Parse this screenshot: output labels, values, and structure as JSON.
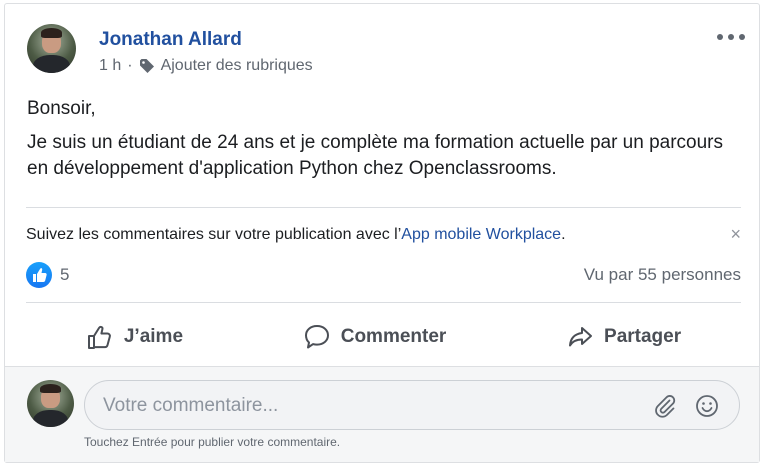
{
  "post": {
    "author": "Jonathan Allard",
    "time": "1 h",
    "separator": "·",
    "add_tags": "Ajouter des rubriques",
    "body": [
      "Bonsoir,",
      "Je suis un étudiant de 24 ans et je complète ma formation actuelle par un parcours en développement d'application Python chez Openclassrooms."
    ]
  },
  "notice": {
    "text": "Suivez les commentaires sur votre publication avec l’",
    "link": "App mobile Workplace",
    "suffix": ".",
    "close": "×"
  },
  "stats": {
    "likes": "5",
    "views": "Vu par 55 personnes"
  },
  "actions": {
    "like": "J’aime",
    "comment": "Commenter",
    "share": "Partager"
  },
  "comment": {
    "placeholder": "Votre commentaire...",
    "hint": "Touchez Entrée pour publier votre commentaire."
  },
  "icons": {
    "more": "more-options-icon",
    "tag": "tag-icon",
    "like_badge": "thumbs-up-icon",
    "like": "thumbs-up-outline-icon",
    "comment": "speech-bubble-icon",
    "share": "share-arrow-icon",
    "attach": "paperclip-icon",
    "emoji": "smiley-icon"
  },
  "colors": {
    "author": "#21509f",
    "link": "#21509f",
    "like_badge": "#1877f2",
    "muted": "#606770"
  }
}
